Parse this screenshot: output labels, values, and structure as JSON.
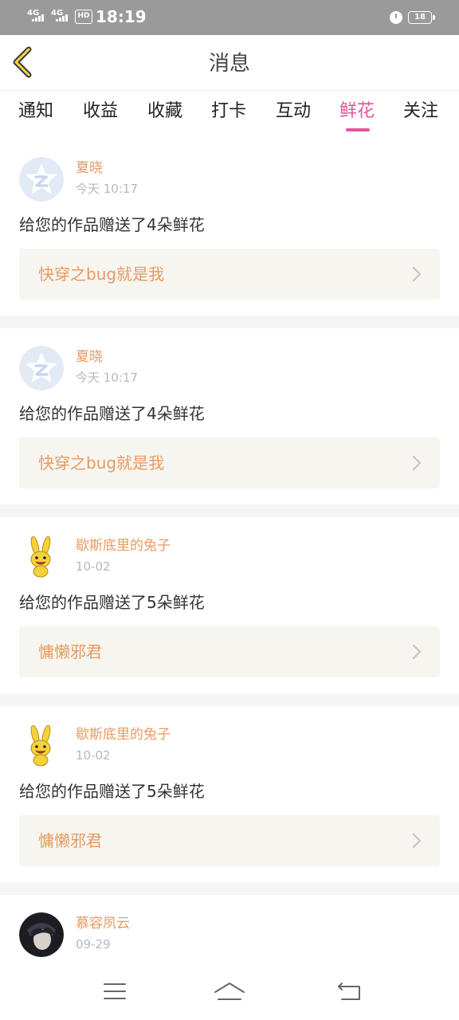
{
  "status_bar": {
    "signal1": "4G",
    "signal2": "4G",
    "hd": "HD",
    "time": "18:19",
    "battery": "18"
  },
  "header": {
    "title": "消息",
    "back_icon": "chevron-left-icon"
  },
  "tabs": [
    {
      "label": "通知",
      "active": false
    },
    {
      "label": "收益",
      "active": false
    },
    {
      "label": "收藏",
      "active": false
    },
    {
      "label": "打卡",
      "active": false
    },
    {
      "label": "互动",
      "active": false
    },
    {
      "label": "鲜花",
      "active": true
    },
    {
      "label": "关注",
      "active": false
    }
  ],
  "feed": [
    {
      "name": "夏晓",
      "time": "今天 10:17",
      "message": "给您的作品赠送了4朵鲜花",
      "work": "快穿之bug就是我",
      "avatar": "default-star-avatar"
    },
    {
      "name": "夏晓",
      "time": "今天 10:17",
      "message": "给您的作品赠送了4朵鲜花",
      "work": "快穿之bug就是我",
      "avatar": "default-star-avatar"
    },
    {
      "name": "歇斯底里的兔子",
      "time": "10-02",
      "message": "给您的作品赠送了5朵鲜花",
      "work": "慵懒邪君",
      "avatar": "yellow-rabbit-avatar"
    },
    {
      "name": "歇斯底里的兔子",
      "time": "10-02",
      "message": "给您的作品赠送了5朵鲜花",
      "work": "慵懒邪君",
      "avatar": "yellow-rabbit-avatar"
    },
    {
      "name": "慕容夙云",
      "time": "09-29",
      "avatar": "dark-portrait-avatar"
    }
  ],
  "nav": [
    "menu-icon",
    "home-icon",
    "back-icon"
  ],
  "colors": {
    "accent": "#e8559a",
    "name_orange": "#e89a62",
    "card_bg": "#f6f5ef",
    "status_bar": "#9a9a9a"
  }
}
